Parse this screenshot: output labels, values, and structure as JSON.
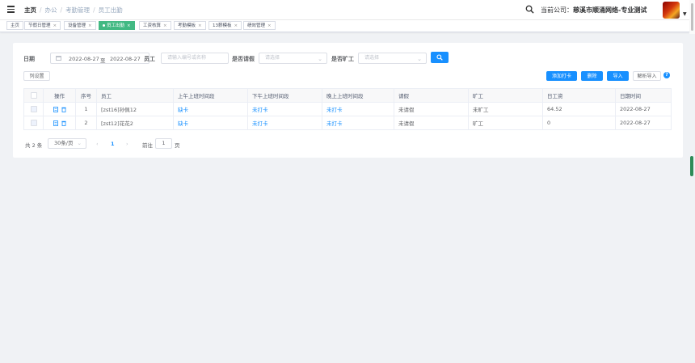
{
  "breadcrumb": [
    "主页",
    "办公",
    "考勤管理",
    "员工出勤"
  ],
  "header": {
    "company_label": "当前公司：",
    "company_name": "慈溪市顺涌网络-专业测试"
  },
  "tags": [
    {
      "label": "主页",
      "closable": false
    },
    {
      "label": "节假日管理",
      "closable": true
    },
    {
      "label": "设备管理",
      "closable": true
    },
    {
      "label": "员工出勤",
      "closable": true,
      "active": true
    },
    {
      "label": "工资核算",
      "closable": true
    },
    {
      "label": "考勤模板",
      "closable": true
    },
    {
      "label": "13薪模板",
      "closable": true
    },
    {
      "label": "绩效管理",
      "closable": true
    }
  ],
  "filters": {
    "date_label": "日期",
    "date_start": "2022-08-27",
    "date_sep": "至",
    "date_end": "2022-08-27",
    "employee_label": "员工",
    "employee_placeholder": "请输入编号或名称",
    "leave_label": "是否请假",
    "leave_placeholder": "请选择",
    "absent_label": "是否旷工",
    "absent_placeholder": "请选择"
  },
  "toolbar": {
    "column_settings": "列设置",
    "add_punch": "添加打卡",
    "delete": "删除",
    "import": "导入",
    "parse_import": "解析导入",
    "help": "?"
  },
  "table": {
    "headers": [
      "操作",
      "序号",
      "员工",
      "上午上班时间段",
      "下午上班时间段",
      "晚上上班时间段",
      "请假",
      "旷工",
      "日工资",
      "日期时间"
    ],
    "rows": [
      [
        "1",
        "[zst16]孙佩12",
        "缺卡",
        "未打卡",
        "未打卡",
        "未请假",
        "未旷工",
        "64.52",
        "2022-08-27"
      ],
      [
        "2",
        "[zst12]花花2",
        "缺卡",
        "未打卡",
        "未打卡",
        "未请假",
        "旷工",
        "0",
        "2022-08-27"
      ]
    ]
  },
  "pagination": {
    "total": "共 2 条",
    "page_size": "30条/页",
    "prev": "‹",
    "current": "1",
    "next": "›",
    "goto_label": "前往",
    "goto_value": "1",
    "page_unit": "页"
  },
  "colors": {
    "primary": "#1890ff",
    "active_tag": "#42b983"
  }
}
